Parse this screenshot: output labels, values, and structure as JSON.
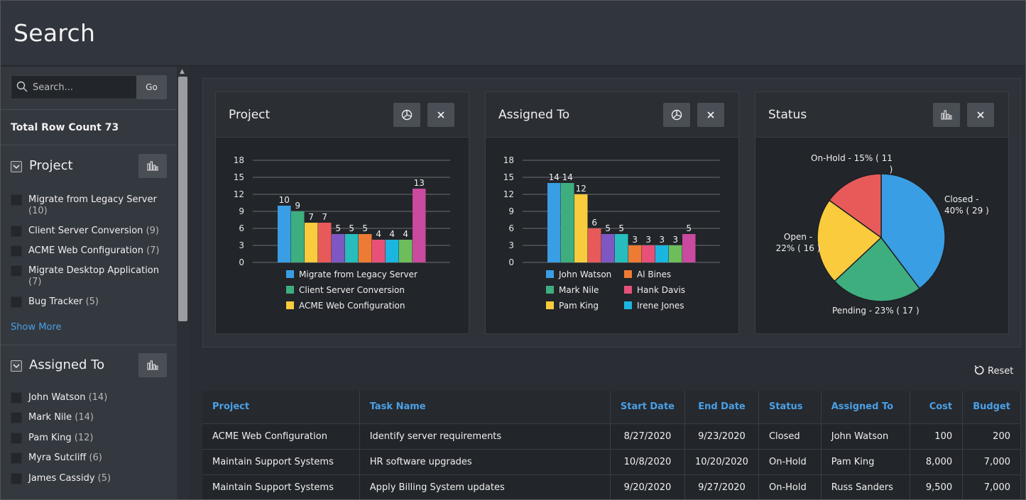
{
  "header": {
    "title": "Search"
  },
  "sidebar": {
    "search_placeholder": "Search...",
    "go_label": "Go",
    "total_label": "Total Row Count 73",
    "facets": [
      {
        "title": "Project",
        "items": [
          {
            "label": "Migrate from Legacy Server",
            "count": "(10)"
          },
          {
            "label": "Client Server Conversion",
            "count": "(9)"
          },
          {
            "label": "ACME Web Configuration",
            "count": "(7)"
          },
          {
            "label": "Migrate Desktop Application",
            "count": "(7)"
          },
          {
            "label": "Bug Tracker",
            "count": "(5)"
          }
        ],
        "show_more": "Show More"
      },
      {
        "title": "Assigned To",
        "items": [
          {
            "label": "John Watson",
            "count": "(14)"
          },
          {
            "label": "Mark Nile",
            "count": "(14)"
          },
          {
            "label": "Pam King",
            "count": "(12)"
          },
          {
            "label": "Myra Sutcliff",
            "count": "(6)"
          },
          {
            "label": "James Cassidy",
            "count": "(5)"
          }
        ]
      }
    ]
  },
  "icons": {
    "search": "search-icon",
    "chart_toggle": "bar-chart-icon",
    "pie_toggle": "pie-chart-icon",
    "close": "close-icon",
    "reset": "reset-icon",
    "chevron": "chevron-down-icon"
  },
  "colors": {
    "blue": "#3a9ee4",
    "green": "#3fae7f",
    "yellow": "#f9cb3d",
    "red": "#e85a5a",
    "purple": "#7e57c2",
    "teal": "#28bdbd",
    "orange": "#ee7b33",
    "pink": "#e8507a",
    "cyan": "#1bb6e0",
    "lime": "#6dbd5b",
    "magenta": "#c94a9e",
    "link": "#4aa0e6"
  },
  "charts": {
    "project_title": "Project",
    "assigned_title": "Assigned To",
    "status_title": "Status"
  },
  "chart_data": [
    {
      "type": "bar",
      "title": "Project",
      "ylim": [
        0,
        18
      ],
      "yticks": [
        "0",
        "3",
        "6",
        "9",
        "12",
        "15",
        "18"
      ],
      "values": [
        10,
        9,
        7,
        7,
        5,
        5,
        5,
        4,
        4,
        4,
        13
      ],
      "colors": [
        "#3a9ee4",
        "#3fae7f",
        "#f9cb3d",
        "#e85a5a",
        "#7e57c2",
        "#28bdbd",
        "#ee7b33",
        "#e8507a",
        "#1bb6e0",
        "#6dbd5b",
        "#c94a9e"
      ],
      "legend": [
        {
          "name": "Migrate from Legacy Server",
          "color": "#3a9ee4"
        },
        {
          "name": "Client Server Conversion",
          "color": "#3fae7f"
        },
        {
          "name": "ACME Web Configuration",
          "color": "#f9cb3d"
        }
      ]
    },
    {
      "type": "bar",
      "title": "Assigned To",
      "ylim": [
        0,
        18
      ],
      "yticks": [
        "0",
        "3",
        "6",
        "9",
        "12",
        "15",
        "18"
      ],
      "values": [
        14,
        14,
        12,
        6,
        5,
        5,
        3,
        3,
        3,
        3,
        5
      ],
      "colors": [
        "#3a9ee4",
        "#3fae7f",
        "#f9cb3d",
        "#e85a5a",
        "#7e57c2",
        "#28bdbd",
        "#ee7b33",
        "#e8507a",
        "#1bb6e0",
        "#6dbd5b",
        "#c94a9e"
      ],
      "legend": [
        {
          "name": "John Watson",
          "color": "#3a9ee4"
        },
        {
          "name": "Al Bines",
          "color": "#ee7b33"
        },
        {
          "name": "Mark Nile",
          "color": "#3fae7f"
        },
        {
          "name": "Hank Davis",
          "color": "#e8507a"
        },
        {
          "name": "Pam King",
          "color": "#f9cb3d"
        },
        {
          "name": "Irene Jones",
          "color": "#1bb6e0"
        }
      ]
    },
    {
      "type": "pie",
      "title": "Status",
      "slices": [
        {
          "name": "Closed",
          "value": 29,
          "label": [
            "Closed -",
            "40% ( 29 )"
          ],
          "color": "#3a9ee4"
        },
        {
          "name": "Pending",
          "value": 17,
          "label": [
            "Pending - 23% ( 17 )"
          ],
          "color": "#3fae7f"
        },
        {
          "name": "Open",
          "value": 16,
          "label": [
            "Open -",
            "22% ( 16 )"
          ],
          "color": "#f9cb3d"
        },
        {
          "name": "On-Hold",
          "value": 11,
          "label": [
            "On-Hold - 15% ( 11",
            ")"
          ],
          "color": "#e85a5a"
        }
      ]
    }
  ],
  "reset_label": "Reset",
  "table": {
    "columns": [
      "Project",
      "Task Name",
      "Start Date",
      "End Date",
      "Status",
      "Assigned To",
      "Cost",
      "Budget"
    ],
    "rows": [
      [
        "ACME Web Configuration",
        "Identify server requirements",
        "8/27/2020",
        "9/23/2020",
        "Closed",
        "John Watson",
        "100",
        "200"
      ],
      [
        "Maintain Support Systems",
        "HR software upgrades",
        "10/8/2020",
        "10/20/2020",
        "On-Hold",
        "Pam King",
        "8,000",
        "7,000"
      ],
      [
        "Maintain Support Systems",
        "Apply Billing System updates",
        "9/20/2020",
        "9/27/2020",
        "On-Hold",
        "Russ Sanders",
        "9,500",
        "7,000"
      ]
    ]
  }
}
